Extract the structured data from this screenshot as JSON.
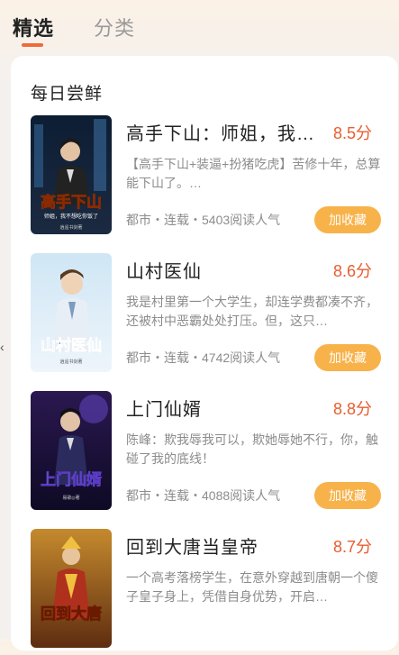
{
  "tabs": [
    {
      "label": "精选",
      "active": true
    },
    {
      "label": "分类",
      "active": false
    }
  ],
  "section": {
    "title": "每日尝鲜"
  },
  "books": [
    {
      "title": "高手下山：师姐，我…",
      "score": "8.5分",
      "desc": "【高手下山+装逼+扮猪吃虎】苦修十年，总算能下山了。…",
      "meta": "都市・连载・5403阅读人气",
      "button": "加收藏",
      "cover_text": "高手下山",
      "cover_subtext": "师姐，我不想吃你饭了",
      "cover_footer": "逍遥书剑著"
    },
    {
      "title": "山村医仙",
      "score": "8.6分",
      "desc": "我是村里第一个大学生，却连学费都凑不齐，还被村中恶霸处处打压。但，这只…",
      "meta": "都市・连载・4742阅读人气",
      "button": "加收藏",
      "cover_text": "山村医仙",
      "cover_footer": "逍遥书剑著"
    },
    {
      "title": "上门仙婿",
      "score": "8.8分",
      "desc": "陈峰：欺我辱我可以，欺她辱她不行，你，触碰了我的底线！",
      "meta": "都市・连载・4088阅读人气",
      "button": "加收藏",
      "cover_text": "上门仙婿",
      "cover_footer": "易歌◎著"
    },
    {
      "title": "回到大唐当皇帝",
      "score": "8.7分",
      "desc": "一个高考落榜学生，在意外穿越到唐朝一个傻子皇子身上，凭借自身优势，开启…",
      "meta": "",
      "button": "",
      "cover_text": "回到大唐"
    }
  ],
  "colors": {
    "accent": "#e85d30",
    "button_bg": "#f8b24a",
    "indicator": "#f06a3a"
  },
  "icons": {
    "side_nav": "chevron-left-icon"
  }
}
